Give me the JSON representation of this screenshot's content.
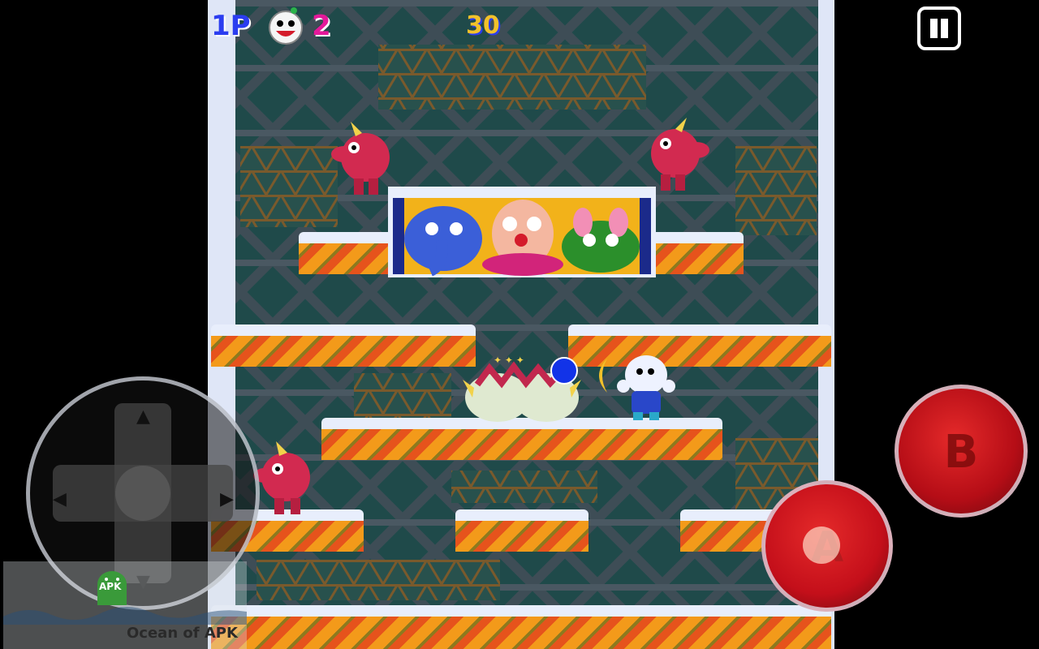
{
  "hud": {
    "player_label": "1P",
    "lives": "2",
    "score": "30",
    "player_label_color": "#2b3df0",
    "lives_color": "#e5199a"
  },
  "controls": {
    "pause_icon": "pause-icon",
    "button_b_label": "B",
    "button_a_label": "A",
    "dpad_icon": "dpad-icon"
  },
  "watermark": {
    "text": "Ocean of APK",
    "logo_text": "APK"
  },
  "colors": {
    "background": "#000000",
    "playfield": "#1d4a48",
    "snow": "#e8eefc",
    "platform_orange": "#f39a1a",
    "enemy_red": "#d22a50",
    "player_blue": "#2947c9",
    "button_red": "#c40f1a"
  }
}
